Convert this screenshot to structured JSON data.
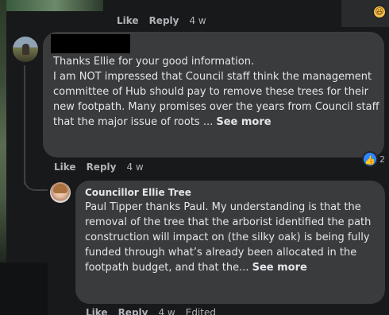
{
  "top_actions": {
    "like": "Like",
    "reply": "Reply",
    "time": "4 w"
  },
  "comment_1": {
    "text": "Thanks Ellie for your good information.\nI am NOT impressed that Council staff think the management committee of Hub should pay to remove these trees for their new footpath. Many promises over the years from Council staff that the major issue of roots ... ",
    "see_more": "See more",
    "actions": {
      "like": "Like",
      "reply": "Reply",
      "time": "4 w"
    },
    "reaction_count": "2"
  },
  "comment_2": {
    "author": "Councillor Ellie Tree",
    "text": "Paul Tipper thanks Paul. My understanding is that the removal of the tree that the arborist identified the path construction will impact on (the silky oak) is being fully funded through what’s already been allocated in the footpath budget, and that the... ",
    "see_more": "See more",
    "actions": {
      "like": "Like",
      "reply": "Reply",
      "time": "4 w",
      "edited": "Edited"
    }
  },
  "icons": {
    "reaction": "laughing-emoji-icon",
    "like_badge": "thumbs-up-icon",
    "colors": {
      "bubble": "#3a3b3c",
      "background": "#18191a",
      "like_blue": "#2d88ff",
      "muted": "#b0b3b8"
    }
  }
}
